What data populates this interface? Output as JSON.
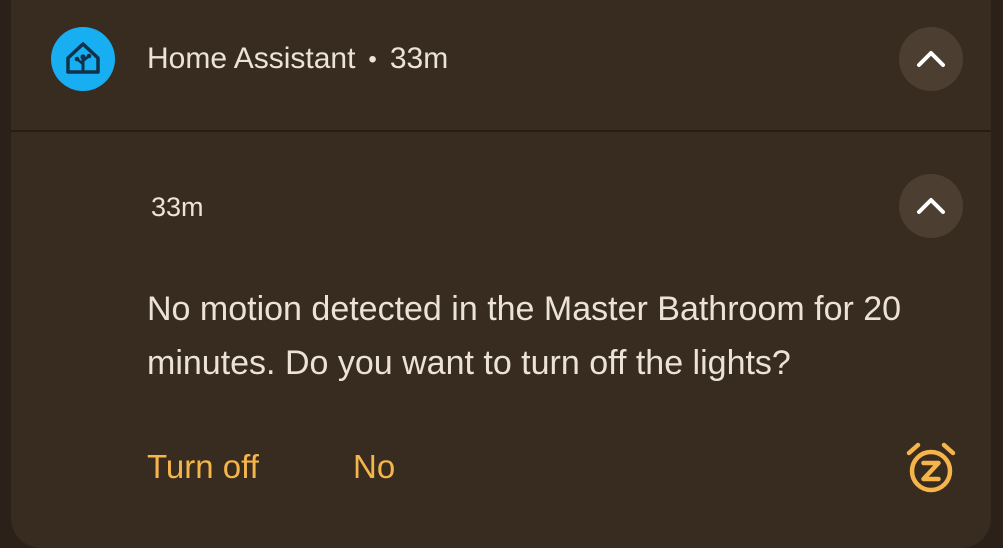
{
  "notification": {
    "app_name": "Home Assistant",
    "separator": "•",
    "time_ago": "33m",
    "detail_time": "33m",
    "message": "No motion detected in the Master Bathroom for 20 minutes. Do you want to turn off the lights?",
    "actions": [
      {
        "label": "Turn off"
      },
      {
        "label": "No"
      }
    ],
    "icons": {
      "app": "home-assistant-icon",
      "collapse": "chevron-up-icon",
      "snooze": "snooze-alarm-icon"
    },
    "colors": {
      "background": "#382c20",
      "app_icon": "#18aef2",
      "action_text": "#f6b54a",
      "body_text": "#ece3d8",
      "button_circle": "#4c3f32"
    }
  }
}
